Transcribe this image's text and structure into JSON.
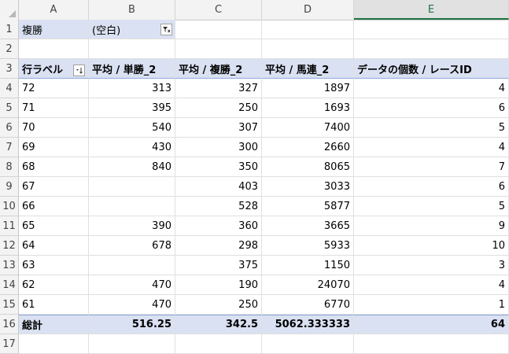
{
  "columns": [
    "A",
    "B",
    "C",
    "D",
    "E"
  ],
  "selected_column": "E",
  "rows_numbers": [
    "1",
    "2",
    "3",
    "4",
    "5",
    "6",
    "7",
    "8",
    "9",
    "10",
    "11",
    "12",
    "13",
    "14",
    "15",
    "16",
    "17"
  ],
  "filter": {
    "label": "複勝",
    "value": "(空白)"
  },
  "header": {
    "row_label": "行ラベル",
    "avg_win": "平均 / 単勝_2",
    "avg_place": "平均 / 複勝_2",
    "avg_quinella": "平均 / 馬連_2",
    "count_race": "データの個数 / レースID"
  },
  "data_rows": [
    {
      "label": "72",
      "win": "313",
      "place": "327",
      "quinella": "1897",
      "count": "4"
    },
    {
      "label": "71",
      "win": "395",
      "place": "250",
      "quinella": "1693",
      "count": "6"
    },
    {
      "label": "70",
      "win": "540",
      "place": "307",
      "quinella": "7400",
      "count": "5"
    },
    {
      "label": "69",
      "win": "430",
      "place": "300",
      "quinella": "2660",
      "count": "4"
    },
    {
      "label": "68",
      "win": "840",
      "place": "350",
      "quinella": "8065",
      "count": "7"
    },
    {
      "label": "67",
      "win": "",
      "place": "403",
      "quinella": "3033",
      "count": "6"
    },
    {
      "label": "66",
      "win": "",
      "place": "528",
      "quinella": "5877",
      "count": "5"
    },
    {
      "label": "65",
      "win": "390",
      "place": "360",
      "quinella": "3665",
      "count": "9"
    },
    {
      "label": "64",
      "win": "678",
      "place": "298",
      "quinella": "5933",
      "count": "10"
    },
    {
      "label": "63",
      "win": "",
      "place": "375",
      "quinella": "1150",
      "count": "3"
    },
    {
      "label": "62",
      "win": "470",
      "place": "190",
      "quinella": "24070",
      "count": "4"
    },
    {
      "label": "61",
      "win": "470",
      "place": "250",
      "quinella": "6770",
      "count": "1"
    }
  ],
  "total": {
    "label": "総計",
    "win": "516.25",
    "place": "342.5",
    "quinella": "5062.333333",
    "count": "64"
  }
}
